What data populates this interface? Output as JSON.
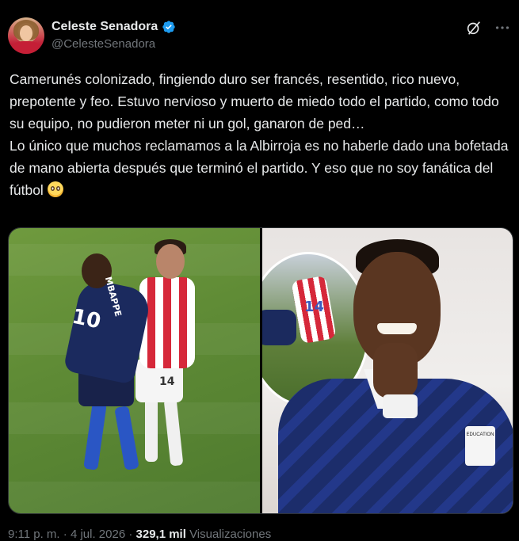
{
  "author": {
    "display_name": "Celeste Senadora",
    "handle": "@CelesteSenadora",
    "verified": true
  },
  "tweet": {
    "text_main": "Camerunés colonizado, fingiendo duro ser francés, resentido, rico nuevo, prepotente y feo. Estuvo nervioso y muerto de miedo todo el partido, como todo su equipo, no pudieron meter ni un gol, ganaron de ped…\nLo único que muchos reclamamos a la Albirroja es no haberle dado una bofetada de mano abierta después que terminó el partido. Y eso que no soy fanática del fútbol ",
    "emoji": "flushed-face"
  },
  "media": {
    "left_jersey_name": "MBAPPE",
    "left_jersey_number_blue": "10",
    "left_jersey_number_red": "14",
    "inset_jersey_number": "14",
    "patch_text": "EDUCATION"
  },
  "meta": {
    "time": "9:11 p. m.",
    "separator": " · ",
    "date": "4 jul. 2026",
    "views": "329,1 mil",
    "views_label": "Visualizaciones"
  },
  "colors": {
    "background": "#000000",
    "text": "#e7e9ea",
    "muted": "#71767b",
    "verified": "#1d9bf0"
  }
}
